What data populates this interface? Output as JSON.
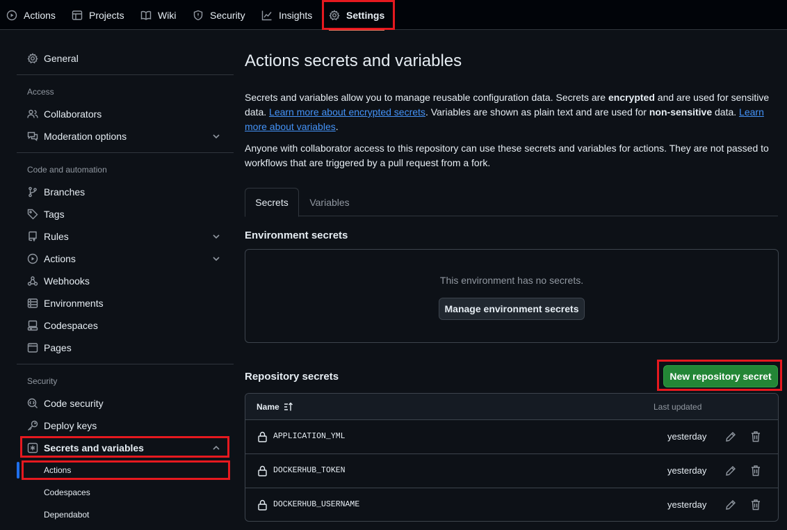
{
  "topnav": {
    "tabs": [
      {
        "label": "Actions",
        "icon": "play-circle-icon"
      },
      {
        "label": "Projects",
        "icon": "table-icon"
      },
      {
        "label": "Wiki",
        "icon": "book-icon"
      },
      {
        "label": "Security",
        "icon": "shield-icon"
      },
      {
        "label": "Insights",
        "icon": "graph-icon"
      },
      {
        "label": "Settings",
        "icon": "gear-icon",
        "active": true
      }
    ]
  },
  "sidebar": {
    "general": "General",
    "access_heading": "Access",
    "collaborators": "Collaborators",
    "moderation": "Moderation options",
    "code_heading": "Code and automation",
    "branches": "Branches",
    "tags": "Tags",
    "rules": "Rules",
    "actions": "Actions",
    "webhooks": "Webhooks",
    "environments": "Environments",
    "codespaces": "Codespaces",
    "pages": "Pages",
    "security_heading": "Security",
    "code_security": "Code security",
    "deploy_keys": "Deploy keys",
    "secrets_vars": "Secrets and variables",
    "sub_actions": "Actions",
    "sub_codespaces": "Codespaces",
    "sub_dependabot": "Dependabot"
  },
  "main": {
    "title": "Actions secrets and variables",
    "intro": {
      "t1": "Secrets and variables allow you to manage reusable configuration data. Secrets are ",
      "b1": "encrypted",
      "t2": " and are used for sensitive data. ",
      "link1": "Learn more about encrypted secrets",
      "t3": ". Variables are shown as plain text and are used for ",
      "b2": "non-sensitive",
      "t4": " data. ",
      "link2": "Learn more about variables",
      "t5": "."
    },
    "note": "Anyone with collaborator access to this repository can use these secrets and variables for actions. They are not passed to workflows that are triggered by a pull request from a fork.",
    "tabs": [
      "Secrets",
      "Variables"
    ],
    "env_heading": "Environment secrets",
    "env_empty": "This environment has no secrets.",
    "env_button": "Manage environment secrets",
    "repo_heading": "Repository secrets",
    "new_secret_button": "New repository secret",
    "table": {
      "col_name": "Name",
      "col_updated": "Last updated",
      "rows": [
        {
          "name": "APPLICATION_YML",
          "updated": "yesterday"
        },
        {
          "name": "DOCKERHUB_TOKEN",
          "updated": "yesterday"
        },
        {
          "name": "DOCKERHUB_USERNAME",
          "updated": "yesterday"
        }
      ]
    }
  },
  "colors": {
    "background": "#0d1117",
    "accent_link": "#4493f8",
    "primary_button": "#238636",
    "highlight_box": "#e5191f",
    "active_indicator": "#1f6feb"
  }
}
